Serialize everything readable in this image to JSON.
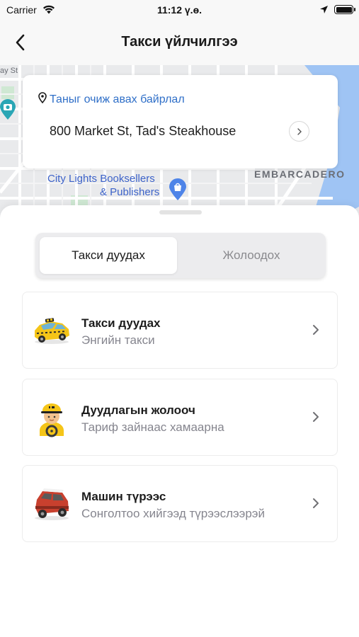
{
  "status_bar": {
    "carrier": "Carrier",
    "time": "11:12 ү.ө."
  },
  "nav": {
    "title": "Такси үйлчилгээ",
    "back_icon": "chevron-left-icon"
  },
  "map": {
    "poi_label_line1": "City Lights Booksellers",
    "poi_label_line2": "& Publishers",
    "district_label": "EMBARCADERO",
    "street_fragment": "ay St",
    "colors": {
      "land": "#e9eaec",
      "water": "#9fc4f4",
      "park": "#cfe8d3",
      "road": "#ffffff"
    }
  },
  "pickup": {
    "label": "Таныг очиж авах байрлал",
    "address": "800 Market St, Tad's Steakhouse",
    "pin_icon": "location-pin-icon",
    "go_icon": "chevron-right-circle-icon"
  },
  "segments": {
    "active_label": "Такси дуудах",
    "inactive_label": "Жолоодох"
  },
  "services": [
    {
      "title": "Такси дуудах",
      "subtitle": "Энгийн такси",
      "icon": "taxi-car-icon"
    },
    {
      "title": "Дуудлагын жолооч",
      "subtitle": "Тариф зайнаас хамаарна",
      "icon": "driver-avatar-icon"
    },
    {
      "title": "Машин түрээс",
      "subtitle": "Сонголтоо хийгээд түрээслээрэй",
      "icon": "rental-jeep-icon"
    }
  ],
  "colors": {
    "accent_blue": "#2f6fc8",
    "subtitle_gray": "#85858e",
    "taxi_yellow": "#f5c518",
    "jeep_red": "#c8402e"
  }
}
